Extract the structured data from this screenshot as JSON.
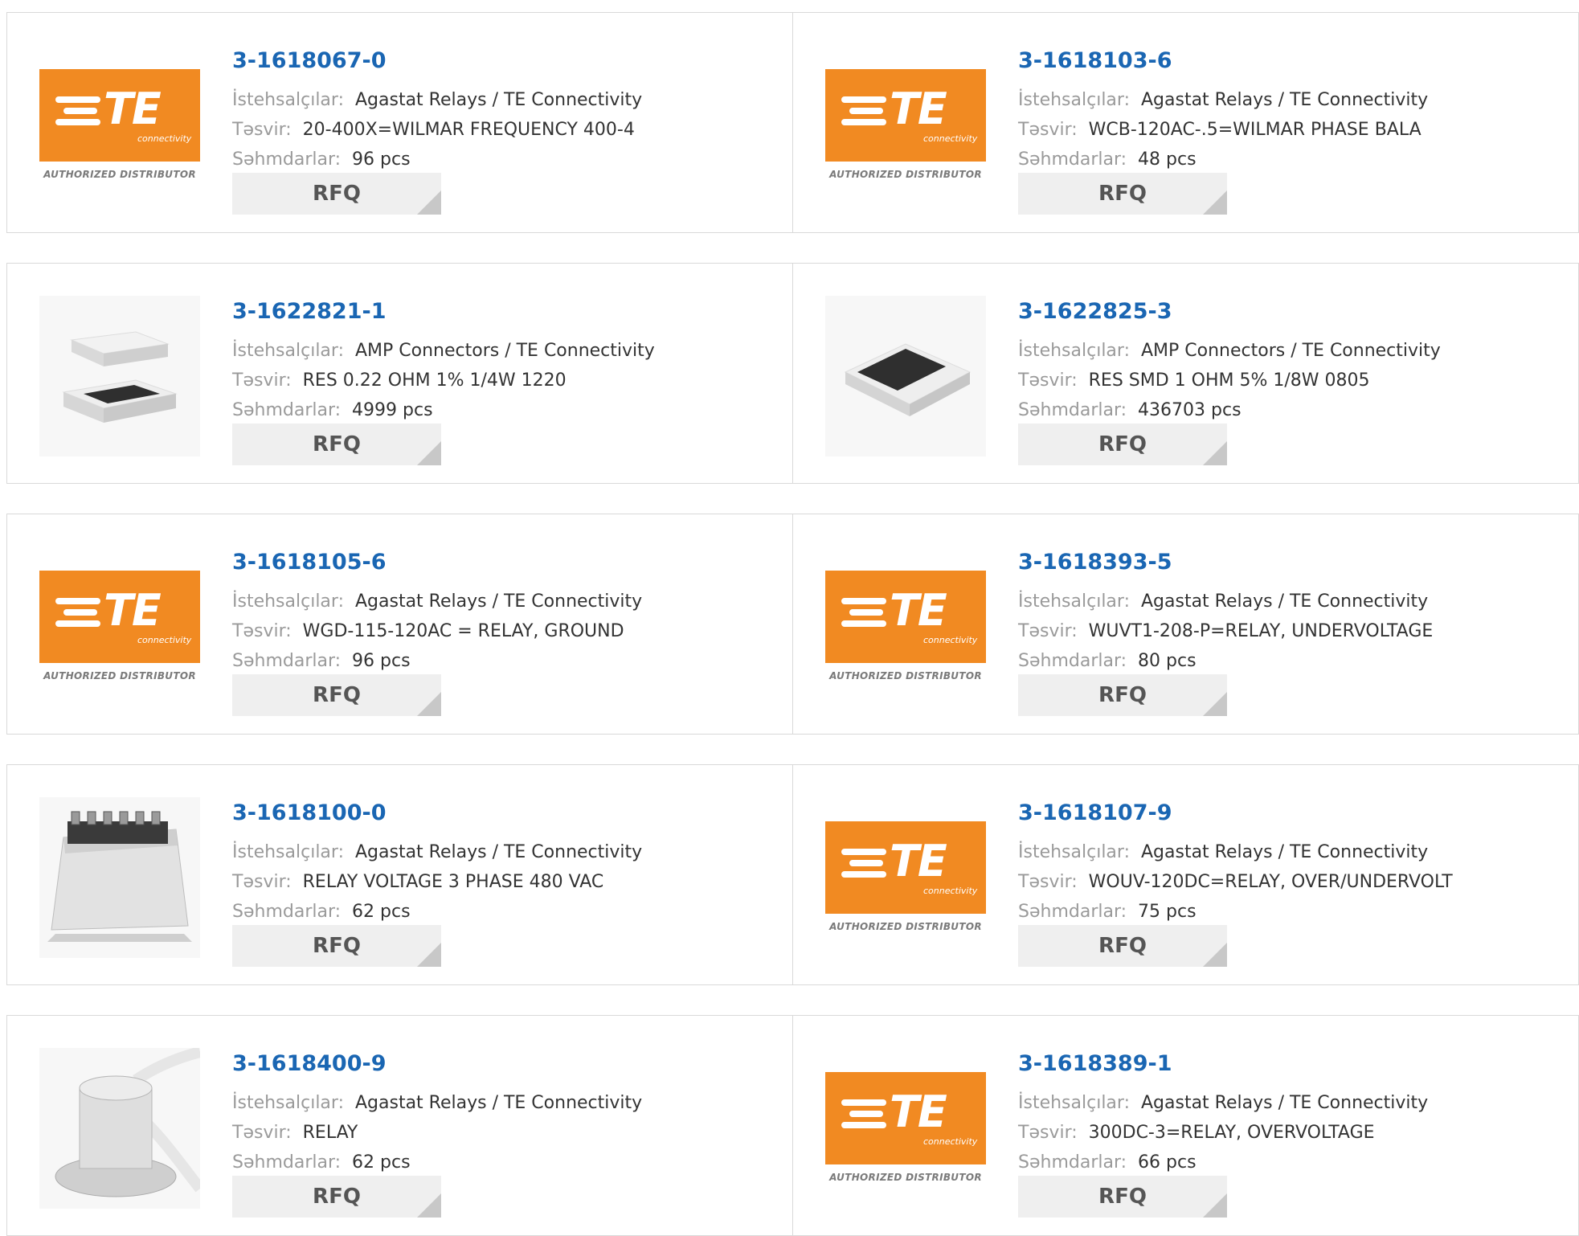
{
  "labels": {
    "manufacturer": "İstehsalçılar:",
    "description": "Təsvir:",
    "stock": "Səhmdarlar:",
    "rfq": "RFQ"
  },
  "logo": {
    "brand_text": "TE",
    "brand_sub": "connectivity",
    "authorized": "AUTHORIZED DISTRIBUTOR",
    "brand_color": "#f18a22"
  },
  "colors": {
    "part_link": "#1a66b3",
    "label": "#9a9a9a",
    "button_bg": "#efefef"
  },
  "products": [
    {
      "part": "3-1618067-0",
      "manufacturer": "Agastat Relays / TE Connectivity",
      "description": "20-400X=WILMAR FREQUENCY 400-4",
      "stock": "96 pcs",
      "image": "te-logo"
    },
    {
      "part": "3-1618103-6",
      "manufacturer": "Agastat Relays / TE Connectivity",
      "description": "WCB-120AC-.5=WILMAR PHASE BALA",
      "stock": "48 pcs",
      "image": "te-logo"
    },
    {
      "part": "3-1622821-1",
      "manufacturer": "AMP Connectors / TE Connectivity",
      "description": "RES 0.22 OHM 1% 1/4W 1220",
      "stock": "4999 pcs",
      "image": "smd-resistor-pair"
    },
    {
      "part": "3-1622825-3",
      "manufacturer": "AMP Connectors / TE Connectivity",
      "description": "RES SMD 1 OHM 5% 1/8W 0805",
      "stock": "436703 pcs",
      "image": "smd-resistor"
    },
    {
      "part": "3-1618105-6",
      "manufacturer": "Agastat Relays / TE Connectivity",
      "description": "WGD-115-120AC = RELAY, GROUND",
      "stock": "96 pcs",
      "image": "te-logo"
    },
    {
      "part": "3-1618393-5",
      "manufacturer": "Agastat Relays / TE Connectivity",
      "description": "WUVT1-208-P=RELAY, UNDERVOLTAGE",
      "stock": "80 pcs",
      "image": "te-logo"
    },
    {
      "part": "3-1618100-0",
      "manufacturer": "Agastat Relays / TE Connectivity",
      "description": "RELAY VOLTAGE 3 PHASE 480 VAC",
      "stock": "62 pcs",
      "image": "relay-box"
    },
    {
      "part": "3-1618107-9",
      "manufacturer": "Agastat Relays / TE Connectivity",
      "description": "WOUV-120DC=RELAY, OVER/UNDERVOLT",
      "stock": "75 pcs",
      "image": "te-logo"
    },
    {
      "part": "3-1618400-9",
      "manufacturer": "Agastat Relays / TE Connectivity",
      "description": "RELAY",
      "stock": "62 pcs",
      "image": "cylinder-relay"
    },
    {
      "part": "3-1618389-1",
      "manufacturer": "Agastat Relays / TE Connectivity",
      "description": "300DC-3=RELAY, OVERVOLTAGE",
      "stock": "66 pcs",
      "image": "te-logo"
    }
  ]
}
